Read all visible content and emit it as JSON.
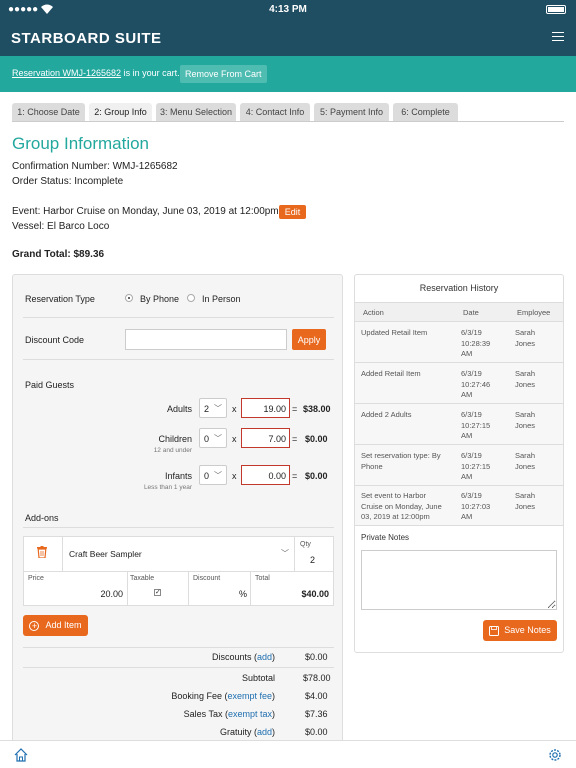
{
  "status_bar": {
    "time": "4:13 PM"
  },
  "app": {
    "title": "STARBOARD SUITE"
  },
  "cart": {
    "reservation_link": "Reservation WMJ-1265682",
    "suffix": " is in your cart.",
    "remove_label": "Remove From Cart"
  },
  "tabs": [
    {
      "label": "1: Choose Date"
    },
    {
      "label": "2: Group Info"
    },
    {
      "label": "3: Menu Selection"
    },
    {
      "label": "4: Contact Info"
    },
    {
      "label": "5: Payment Info"
    },
    {
      "label": "6: Complete"
    }
  ],
  "page": {
    "title": "Group Information",
    "confirmation": "Confirmation Number: WMJ-1265682",
    "order_status": "Order Status: Incomplete",
    "event": "Event: Harbor Cruise on Monday, June 03, 2019 at 12:00pm",
    "edit_label": "Edit",
    "vessel": "Vessel: El Barco Loco",
    "grand_total": "Grand Total: $89.36"
  },
  "form": {
    "reservation_type_label": "Reservation Type",
    "by_phone": "By Phone",
    "in_person": "In Person",
    "discount_code_label": "Discount Code",
    "discount_code_value": "",
    "apply_label": "Apply",
    "paid_guests_label": "Paid Guests",
    "guests": [
      {
        "label": "Adults",
        "sub": "",
        "qty": "2",
        "price": "19.00",
        "total": "$38.00"
      },
      {
        "label": "Children",
        "sub": "12 and under",
        "qty": "0",
        "price": "7.00",
        "total": "$0.00"
      },
      {
        "label": "Infants",
        "sub": "Less than 1 year",
        "qty": "0",
        "price": "0.00",
        "total": "$0.00"
      }
    ],
    "times": "x",
    "equals": "=",
    "addons_label": "Add-ons",
    "addon": {
      "name": "Craft Beer Sampler",
      "qty_label": "Qty",
      "qty": "2",
      "price_label": "Price",
      "price": "20.00",
      "taxable_label": "Taxable",
      "discount_label": "Discount",
      "discount_unit": "%",
      "total_label": "Total",
      "total": "$40.00"
    },
    "add_item_label": "Add Item",
    "summary": [
      {
        "label": "Discounts",
        "link": "add",
        "value": "$0.00"
      },
      {
        "label": "Subtotal",
        "link": "",
        "value": "$78.00"
      },
      {
        "label": "Booking Fee",
        "link": "exempt fee",
        "value": "$4.00"
      },
      {
        "label": "Sales Tax",
        "link": "exempt tax",
        "value": "$7.36"
      },
      {
        "label": "Gratuity",
        "link": "add",
        "value": "$0.00"
      }
    ]
  },
  "history": {
    "title": "Reservation History",
    "headers": [
      "Action",
      "Date",
      "Employee"
    ],
    "rows": [
      {
        "action": [
          "Updated Retail Item"
        ],
        "date": [
          "6/3/19",
          "10:28:39",
          "AM"
        ],
        "employee": [
          "Sarah",
          "Jones"
        ]
      },
      {
        "action": [
          "Added Retail Item"
        ],
        "date": [
          "6/3/19",
          "10:27:46",
          "AM"
        ],
        "employee": [
          "Sarah",
          "Jones"
        ]
      },
      {
        "action": [
          "Added 2 Adults"
        ],
        "date": [
          "6/3/19",
          "10:27:15",
          "AM"
        ],
        "employee": [
          "Sarah",
          "Jones"
        ]
      },
      {
        "action": [
          "Set reservation type: By",
          "Phone"
        ],
        "date": [
          "6/3/19",
          "10:27:15",
          "AM"
        ],
        "employee": [
          "Sarah",
          "Jones"
        ]
      },
      {
        "action": [
          "Set event to Harbor",
          "Cruise on Monday, June",
          "03, 2019 at 12:00pm"
        ],
        "date": [
          "6/3/19",
          "10:27:03",
          "AM"
        ],
        "employee": [
          "Sarah",
          "Jones"
        ]
      }
    ],
    "notes_label": "Private Notes",
    "save_label": "Save Notes"
  },
  "colors": {
    "navy": "#1f4e63",
    "teal": "#23a89e",
    "orange": "#e8681e"
  }
}
